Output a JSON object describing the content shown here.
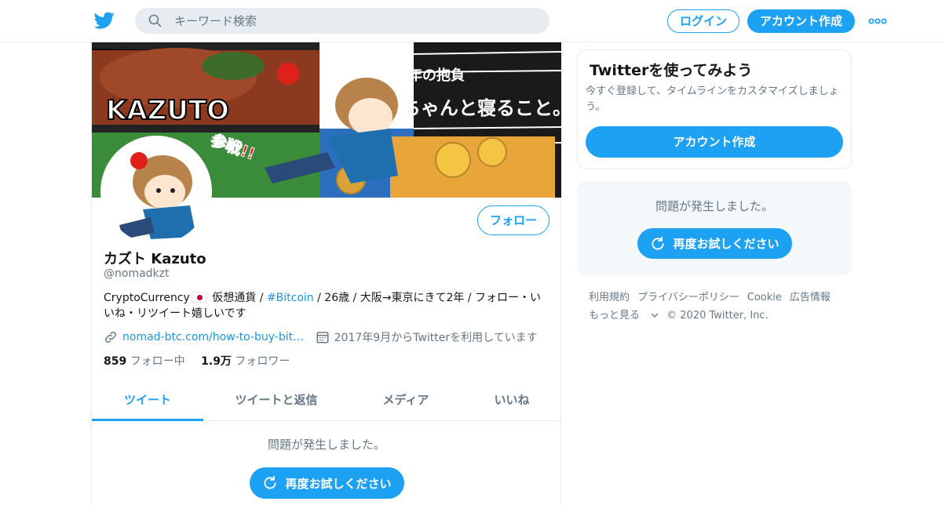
{
  "header": {
    "logo": "twitter-bird-icon",
    "search_placeholder": "キーワード検索",
    "login_label": "ログイン",
    "signup_label": "アカウント作成",
    "more_icon": "more-dots-icon"
  },
  "profile": {
    "banner_text_1": "KAZUTO",
    "banner_text_2": "今年の抱負",
    "banner_text_3": "ちゃんと寝ること。",
    "banner_text_4": "参戦!!",
    "follow_label": "フォロー",
    "name": "カズト Kazuto",
    "handle": "@nomadkzt",
    "bio_part1": "CryptoCurrency",
    "bio_part2": " 仮想通貨 / ",
    "bio_hashtag": "#Bitcoin",
    "bio_part3": " / 26歳 / 大阪→東京にきて2年 / フォロー・いいね・リツイート嬉しいです",
    "website": "nomad-btc.com/how-to-buy-bit…",
    "joined": "2017年9月からTwitterを利用しています",
    "following_count": "859",
    "following_label": "フォロー中",
    "followers_count": "1.9万",
    "followers_label": "フォロワー"
  },
  "tabs": [
    "ツイート",
    "ツイートと返信",
    "メディア",
    "いいね"
  ],
  "timeline": {
    "error_text": "問題が発生しました。",
    "retry_label": "再度お試しください"
  },
  "sidebar": {
    "try_title": "Twitterを使ってみよう",
    "try_desc": "今すぐ登録して、タイムラインをカスタマイズしましょう。",
    "try_button": "アカウント作成",
    "error_text": "問題が発生しました。",
    "retry_label": "再度お試しください"
  },
  "footer": {
    "links": [
      "利用規約",
      "プライバシーポリシー",
      "Cookie",
      "広告情報",
      "もっと見る"
    ],
    "copyright": "© 2020 Twitter, Inc."
  },
  "colors": {
    "accent": "#1da1f2",
    "link": "#1b95e0",
    "muted": "#657786"
  }
}
